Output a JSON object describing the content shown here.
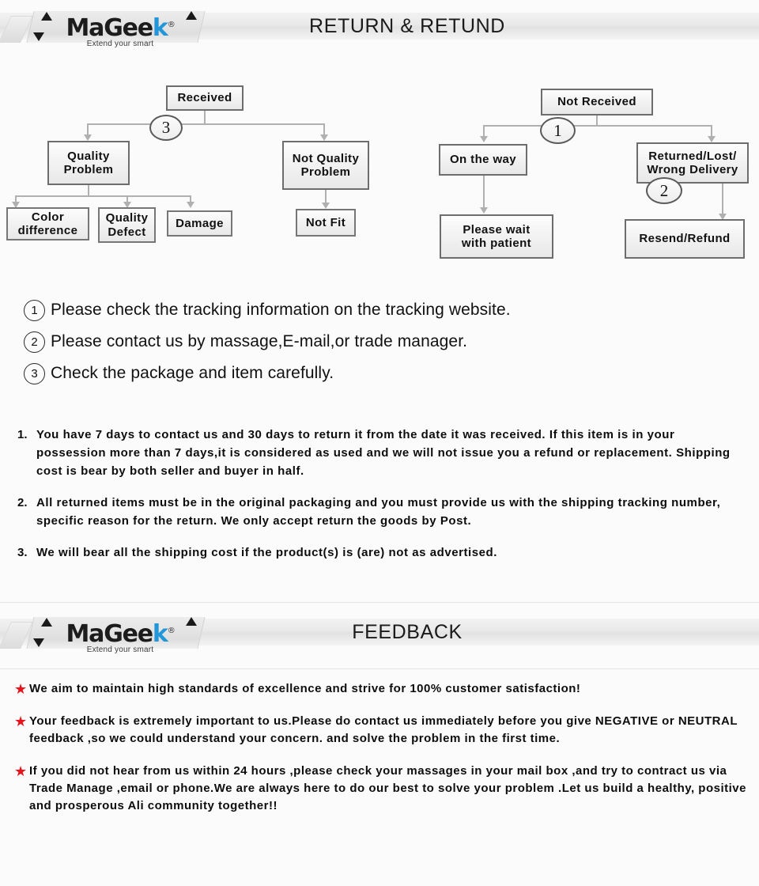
{
  "brand": {
    "name_part1": "MaGee",
    "name_part2": "k",
    "registered": "®",
    "tagline": "Extend your smart"
  },
  "banners": [
    {
      "title": "RETURN & RETUND"
    },
    {
      "title": "FEEDBACK"
    }
  ],
  "flowchart": {
    "left": {
      "root": "Received",
      "marker": "3",
      "children": [
        {
          "label": "Quality\nProblem",
          "children": [
            "Color\ndifference",
            "Quality\nDefect",
            "Damage"
          ]
        },
        {
          "label": "Not Quality\nProblem",
          "children": [
            "Not Fit"
          ]
        }
      ]
    },
    "right": {
      "root": "Not  Received",
      "marker": "1",
      "marker2": "2",
      "children": [
        {
          "label": "On the way",
          "children": [
            "Please wait\nwith patient"
          ]
        },
        {
          "label": "Returned/Lost/\nWrong Delivery",
          "children": [
            "Resend/Refund"
          ]
        }
      ]
    },
    "nodes": {
      "received": "Received",
      "not_received": "Not  Received",
      "quality_problem": "Quality\nProblem",
      "not_quality_problem": "Not Quality\nProblem",
      "color_difference": "Color\ndifference",
      "quality_defect": "Quality\nDefect",
      "damage": "Damage",
      "not_fit": "Not Fit",
      "on_the_way": "On the way",
      "returned_lost": "Returned/Lost/\nWrong Delivery",
      "please_wait": "Please wait\nwith patient",
      "resend_refund": "Resend/Refund"
    },
    "markers": {
      "one": "1",
      "two": "2",
      "three": "3"
    }
  },
  "notes": [
    {
      "num": "1",
      "text": "Please check the tracking information on the tracking website."
    },
    {
      "num": "2",
      "text": "Please contact us by  massage,E-mail,or trade manager."
    },
    {
      "num": "3",
      "text": "Check the package and item carefully."
    }
  ],
  "policies": [
    {
      "num": "1.",
      "text": "You have 7 days to contact us and 30 days to return it from the date it was received. If this item is in your possession more than 7 days,it is considered as used and we will not issue you a refund or replacement. Shipping cost is bear by both seller and buyer in half."
    },
    {
      "num": "2.",
      "text": "All returned items must be in the original packaging and you must provide us with the shipping tracking number, specific reason for the return. We only accept return the goods by Post."
    },
    {
      "num": "3.",
      "text": "We will bear all the shipping cost if the product(s) is (are) not as advertised."
    }
  ],
  "feedback": [
    {
      "bullet": "★",
      "text": "We aim to maintain high standards of excellence and strive  for 100% customer satisfaction!"
    },
    {
      "bullet": "★",
      "text": "Your feedback is extremely important to us.Please do contact us immediately before you give NEGATIVE or NEUTRAL feedback ,so  we could understand your concern. and solve the problem in the first time."
    },
    {
      "bullet": "★",
      "text": "If you did not hear from us within 24 hours ,please check your massages in your mail box ,and try to contract us via Trade Manage ,email or phone.We are always here to do our best to solve your problem .Let us build a healthy, positive and prosperous Ali community together!!"
    }
  ],
  "colors": {
    "background": "#fbfbfb",
    "star": "#e8131a",
    "logo_accent": "#2196d8",
    "node_border": "#6d6d6d",
    "connector": "#b0b0b0"
  }
}
